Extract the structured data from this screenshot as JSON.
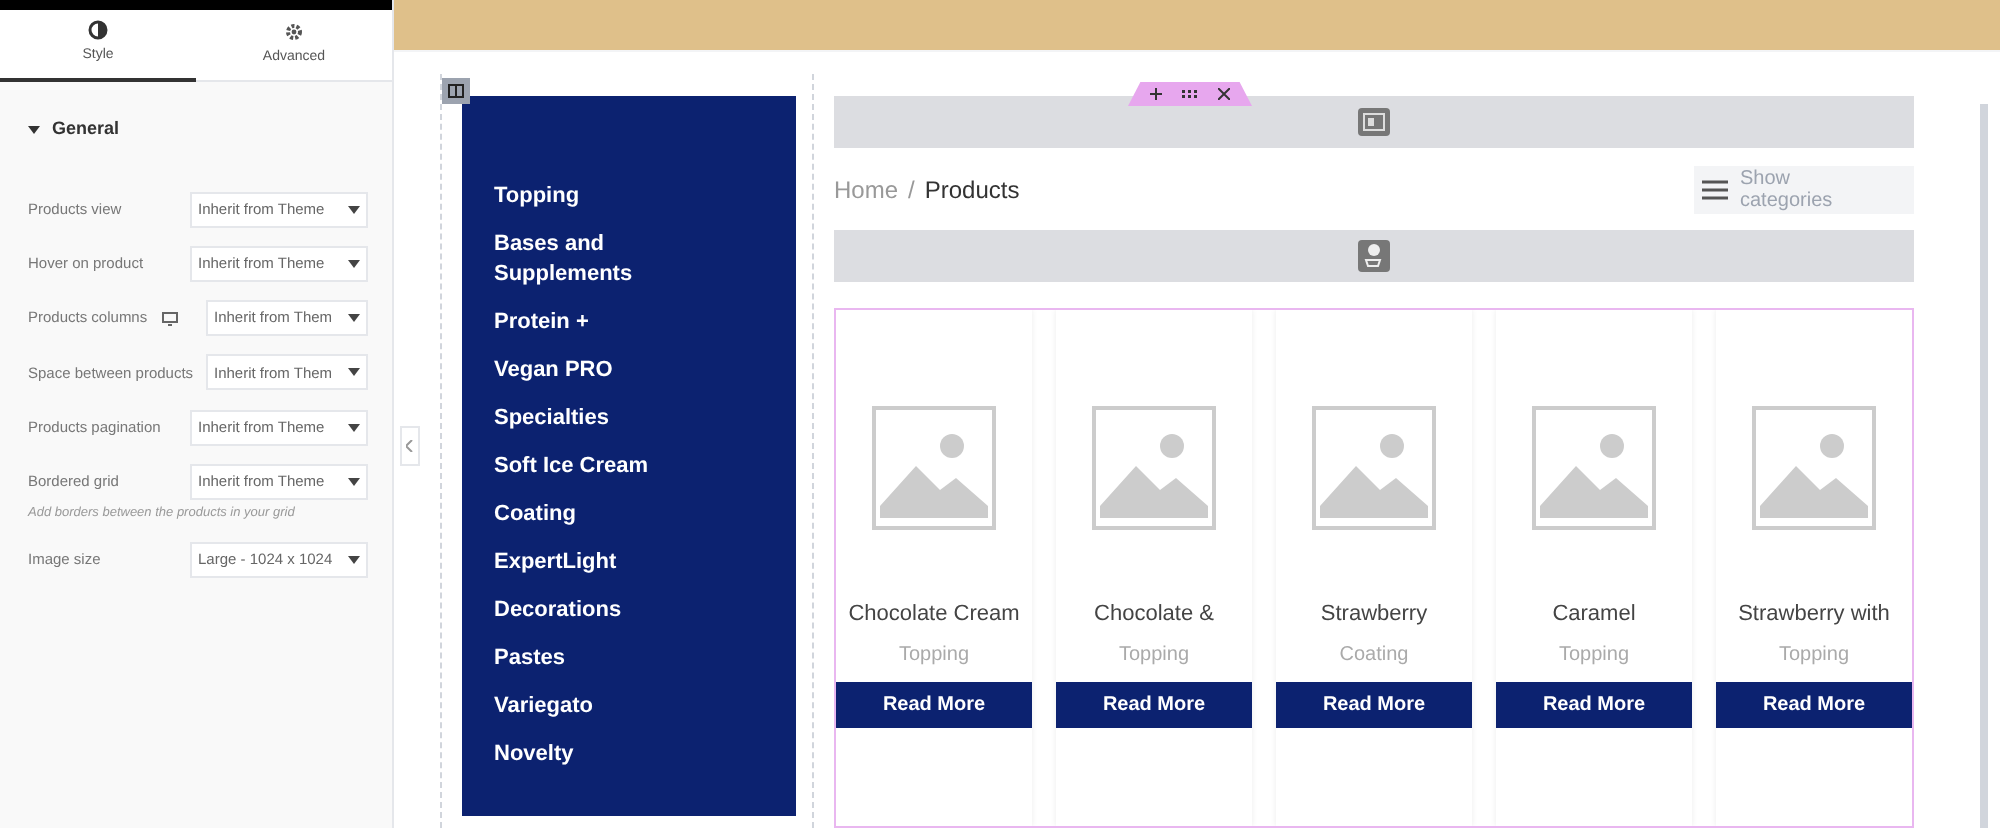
{
  "panel": {
    "tabs": [
      {
        "label": "Style",
        "selected": true
      },
      {
        "label": "Advanced",
        "selected": false
      }
    ],
    "section": {
      "title": "General",
      "expanded": true
    },
    "controls": [
      {
        "label": "Products view",
        "value": "Inherit from Theme",
        "device_icon": false
      },
      {
        "label": "Hover on product",
        "value": "Inherit from Theme",
        "device_icon": false
      },
      {
        "label": "Products columns",
        "value": "Inherit from Them",
        "device_icon": true
      },
      {
        "label": "Space between products",
        "value": "Inherit from Them",
        "device_icon": false
      },
      {
        "label": "Products pagination",
        "value": "Inherit from Theme",
        "device_icon": false
      },
      {
        "label": "Bordered grid",
        "value": "Inherit from Theme",
        "device_icon": false,
        "hint": "Add borders between the products in your grid"
      },
      {
        "label": "Image size",
        "value": "Large - 1024 x 1024",
        "device_icon": false
      }
    ]
  },
  "categories": [
    "Topping",
    "Bases and Supplements",
    "Protein +",
    "Vegan PRO",
    "Specialties",
    "Soft Ice Cream",
    "Coating",
    "ExpertLight",
    "Decorations",
    "Pastes",
    "Variegato",
    "Novelty"
  ],
  "breadcrumb": {
    "home": "Home",
    "separator": "/",
    "current": "Products"
  },
  "show_categories": "Show categories",
  "products": [
    {
      "name": "Chocolate Cream",
      "category": "Topping",
      "button": "Read More"
    },
    {
      "name": "Chocolate &",
      "category": "Topping",
      "button": "Read More"
    },
    {
      "name": "Strawberry",
      "category": "Coating",
      "button": "Read More"
    },
    {
      "name": "Caramel",
      "category": "Topping",
      "button": "Read More"
    },
    {
      "name": "Strawberry with",
      "category": "Topping",
      "button": "Read More"
    }
  ]
}
